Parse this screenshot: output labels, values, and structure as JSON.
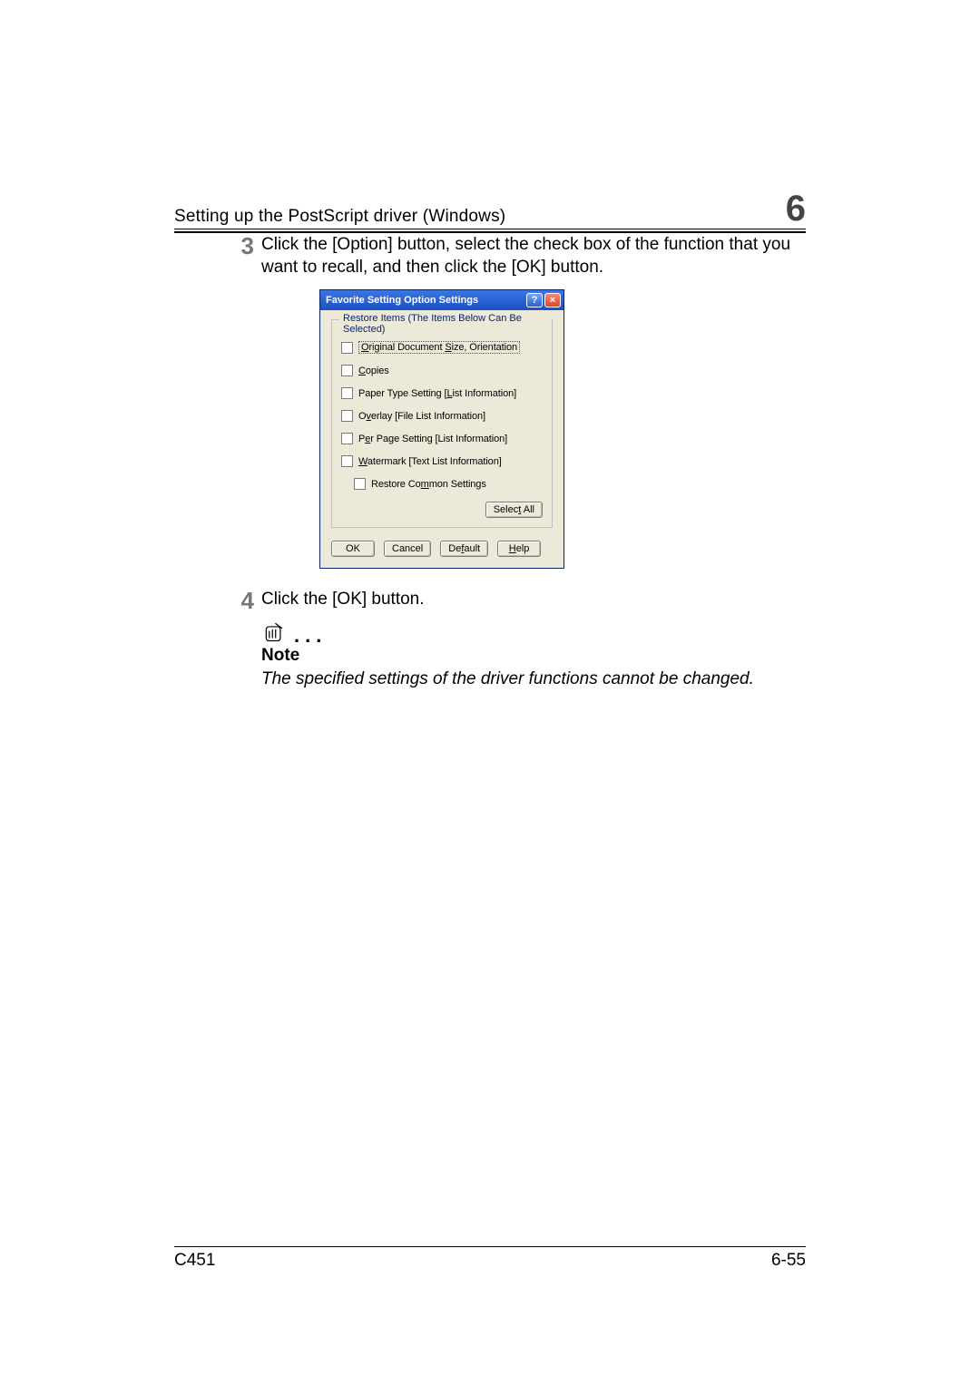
{
  "header": {
    "title": "Setting up the PostScript driver (Windows)",
    "chapter": "6"
  },
  "steps": {
    "s3": {
      "num": "3",
      "text": "Click the [Option] button, select the check box of the function that you want to recall, and then click the [OK] button."
    },
    "s4": {
      "num": "4",
      "text": "Click the [OK] button."
    }
  },
  "dialog": {
    "title": "Favorite Setting Option Settings",
    "help_btn": "?",
    "close_btn": "×",
    "group_legend": "Restore Items (The Items Below Can Be Selected)",
    "items": {
      "orig_a": "O",
      "orig_b": "riginal Document ",
      "orig_c": "S",
      "orig_d": "ize, Orientation",
      "copies_a": "C",
      "copies_b": "opies",
      "paper_a": "Paper Type Setting [",
      "paper_b": "L",
      "paper_c": "ist Information]",
      "overlay_a": "O",
      "overlay_b": "v",
      "overlay_c": "erlay [File List Information]",
      "perpage_a": "P",
      "perpage_b": "e",
      "perpage_c": "r Page Setting [List Information]",
      "wm_a": "W",
      "wm_b": "atermark [Text List Information]",
      "common_a": "Restore Co",
      "common_b": "m",
      "common_c": "mon Settings"
    },
    "select_all_a": "Selec",
    "select_all_b": "t",
    "select_all_c": " All",
    "ok": "OK",
    "cancel": "Cancel",
    "default_a": "De",
    "default_b": "f",
    "default_c": "ault",
    "help_a": "H",
    "help_b": "elp"
  },
  "note": {
    "label": "Note",
    "text": "The specified settings of the driver functions cannot be changed."
  },
  "footer": {
    "model": "C451",
    "page": "6-55"
  }
}
